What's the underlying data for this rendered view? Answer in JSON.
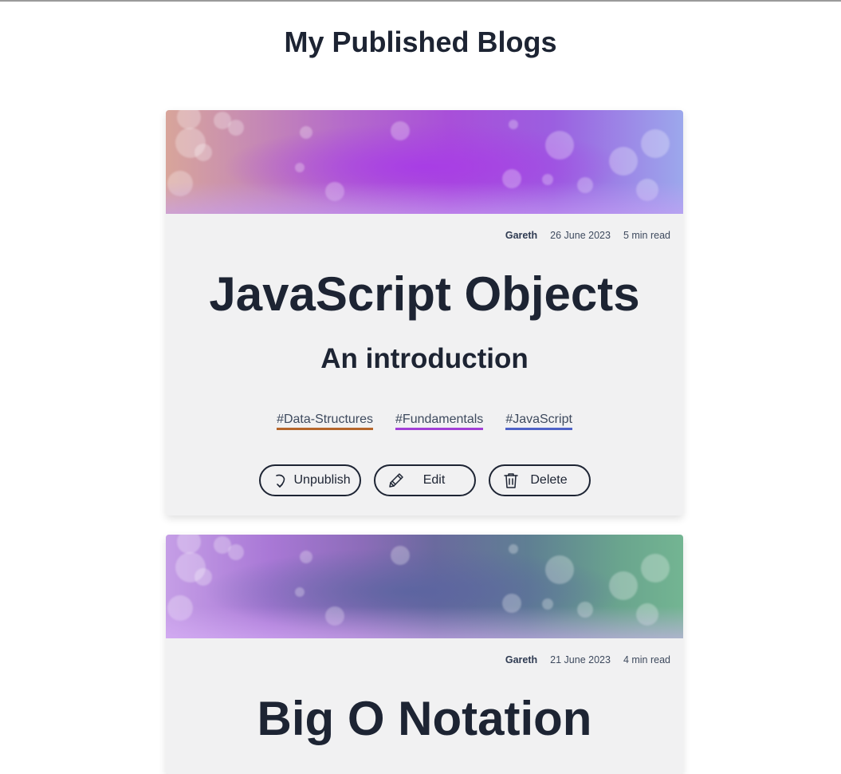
{
  "page": {
    "title": "My Published Blogs"
  },
  "colors": {
    "tag_data_structures": "#b5652b",
    "tag_fundamentals": "#a23fd6",
    "tag_javascript": "#4f62c7",
    "text_dark": "#1d2433"
  },
  "blogs": [
    {
      "author": "Gareth",
      "date": "26 June 2023",
      "read_time": "5 min read",
      "title": "JavaScript Objects",
      "subtitle": "An introduction",
      "tags": [
        "#Data-Structures",
        "#Fundamentals",
        "#JavaScript"
      ],
      "actions": {
        "unpublish": "Unpublish",
        "edit": "Edit",
        "delete": "Delete"
      },
      "icons": {
        "unpublish": "undo-arrow-icon",
        "edit": "pencil-icon",
        "delete": "trash-icon"
      }
    },
    {
      "author": "Gareth",
      "date": "21 June 2023",
      "read_time": "4 min read",
      "title": "Big O Notation"
    }
  ]
}
